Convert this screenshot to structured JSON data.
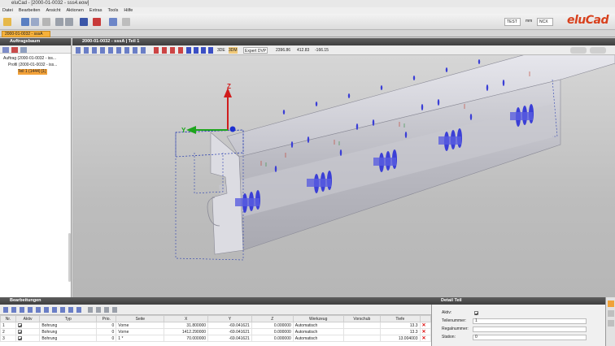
{
  "window": {
    "title": "eluCad - [2000-01-0032 - sss4.eow]"
  },
  "menu": [
    "Datei",
    "Bearbeiten",
    "Ansicht",
    "Aktionen",
    "Extras",
    "Tools",
    "Hilfe"
  ],
  "toolbar": {
    "profile_combo": "TEST",
    "unit_label": "mm",
    "format_combo": "NCX"
  },
  "brand": {
    "logo_text": "eluCad",
    "accent": "#d8401c"
  },
  "doc_tab": {
    "label": "2000-01-0032 - sssA"
  },
  "tree_panel": {
    "title": "Auftragsbaum",
    "items": [
      {
        "label": "Auftrag (2000-01-0032 - iss...",
        "level": 0
      },
      {
        "label": "Profil (2000-01-0032 - iss...",
        "level": 1
      },
      {
        "label": "Teil 1 (1444) [1]",
        "level": 2,
        "selected": true
      }
    ]
  },
  "viewport": {
    "title": "2000-01-0032 - sssA | Teil 1",
    "view_3de": "3DE",
    "view_3dm": "3DM",
    "mode_combo": "Expert DVP",
    "coord_x": "2396.86",
    "coord_y": "412.83",
    "coord_z": "-166.15",
    "axis_z": "Z",
    "axis_y": "Y"
  },
  "operations": {
    "title": "Bearbeitungen",
    "columns": [
      "Nr.",
      "Aktiv",
      "Typ",
      "Prio.",
      "Seite",
      "X",
      "Y",
      "Z",
      "Werkzeug",
      "Vorschub",
      "Tiefe"
    ],
    "rows": [
      {
        "nr": "1",
        "typ": "Bohrung",
        "prio": "0",
        "seite": "Vorne",
        "x": "31.800000",
        "y": "-69.041621",
        "z": "0.000000",
        "werkzeug": "Automatisch",
        "vorschub": "",
        "tiefe": "13.3"
      },
      {
        "nr": "2",
        "typ": "Bohrung",
        "prio": "0",
        "seite": "Vorne",
        "x": "1412.290000",
        "y": "-69.041621",
        "z": "0.000000",
        "werkzeug": "Automatisch",
        "vorschub": "",
        "tiefe": "13.3"
      },
      {
        "nr": "3",
        "typ": "Bohrung",
        "prio": "0",
        "seite": "1 *",
        "x": "70.000000",
        "y": "-69.041621",
        "z": "0.000000",
        "werkzeug": "Automatisch",
        "vorschub": "",
        "tiefe": "13.004003"
      },
      {
        "nr": "4",
        "typ": "Bohrung",
        "prio": "0",
        "seite": "1 *",
        "x": "",
        "y": "",
        "z": "",
        "werkzeug": "",
        "vorschub": "",
        "tiefe": ""
      }
    ]
  },
  "detail_panel": {
    "title": "Detail Teil",
    "fields": [
      {
        "label": "Aktiv:",
        "value": ""
      },
      {
        "label": "Teilenummer:",
        "value": "1"
      },
      {
        "label": "Regalnummer:",
        "value": ""
      },
      {
        "label": "Station:",
        "value": "0"
      }
    ]
  }
}
